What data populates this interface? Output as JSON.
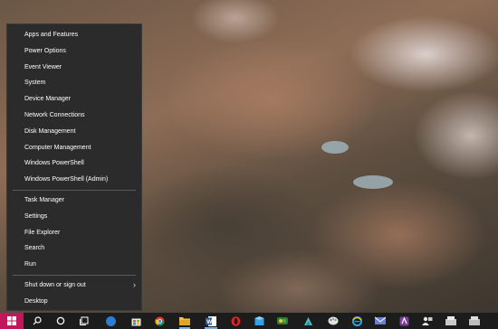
{
  "winx_menu": {
    "items": [
      {
        "label": "Apps and Features"
      },
      {
        "label": "Power Options"
      },
      {
        "label": "Event Viewer"
      },
      {
        "label": "System"
      },
      {
        "label": "Device Manager"
      },
      {
        "label": "Network Connections"
      },
      {
        "label": "Disk Management"
      },
      {
        "label": "Computer Management"
      },
      {
        "label": "Windows PowerShell"
      },
      {
        "label": "Windows PowerShell (Admin)"
      },
      {
        "label": "Task Manager"
      },
      {
        "label": "Settings"
      },
      {
        "label": "File Explorer"
      },
      {
        "label": "Search"
      },
      {
        "label": "Run"
      },
      {
        "label": "Shut down or sign out"
      },
      {
        "label": "Desktop"
      }
    ],
    "submenu_glyph": "›"
  },
  "taskbar": {
    "icons": [
      {
        "name": "start-button",
        "color": "#e8437f"
      },
      {
        "name": "search-icon",
        "color": "#ffffff"
      },
      {
        "name": "cortana-icon",
        "color": "#ffffff"
      },
      {
        "name": "task-view-icon",
        "color": "#ffffff"
      },
      {
        "name": "edge-icon",
        "color": "#2d7bd4"
      },
      {
        "name": "store-icon",
        "color": "#f2f2f2"
      },
      {
        "name": "chrome-icon",
        "color": "#e8b93b"
      },
      {
        "name": "file-explorer-icon",
        "color": "#f1c34a"
      },
      {
        "name": "word-icon",
        "color": "#2b5797"
      },
      {
        "name": "opera-icon",
        "color": "#e0242f"
      },
      {
        "name": "app-blue-icon",
        "color": "#3aa0e0"
      },
      {
        "name": "app-green-icon",
        "color": "#5aa541"
      },
      {
        "name": "app-teal-icon",
        "color": "#4dbfbf"
      },
      {
        "name": "app-paint-icon",
        "color": "#d9d9d9"
      },
      {
        "name": "ie-icon",
        "color": "#f3c019"
      },
      {
        "name": "app-mail-icon",
        "color": "#6a7fd8"
      },
      {
        "name": "app-purple-icon",
        "color": "#a44fb4"
      },
      {
        "name": "people-icon",
        "color": "#e6e6e6"
      },
      {
        "name": "app-gray-icon",
        "color": "#c9c9c9"
      },
      {
        "name": "app-gray2-icon",
        "color": "#bdbdbd"
      }
    ]
  }
}
